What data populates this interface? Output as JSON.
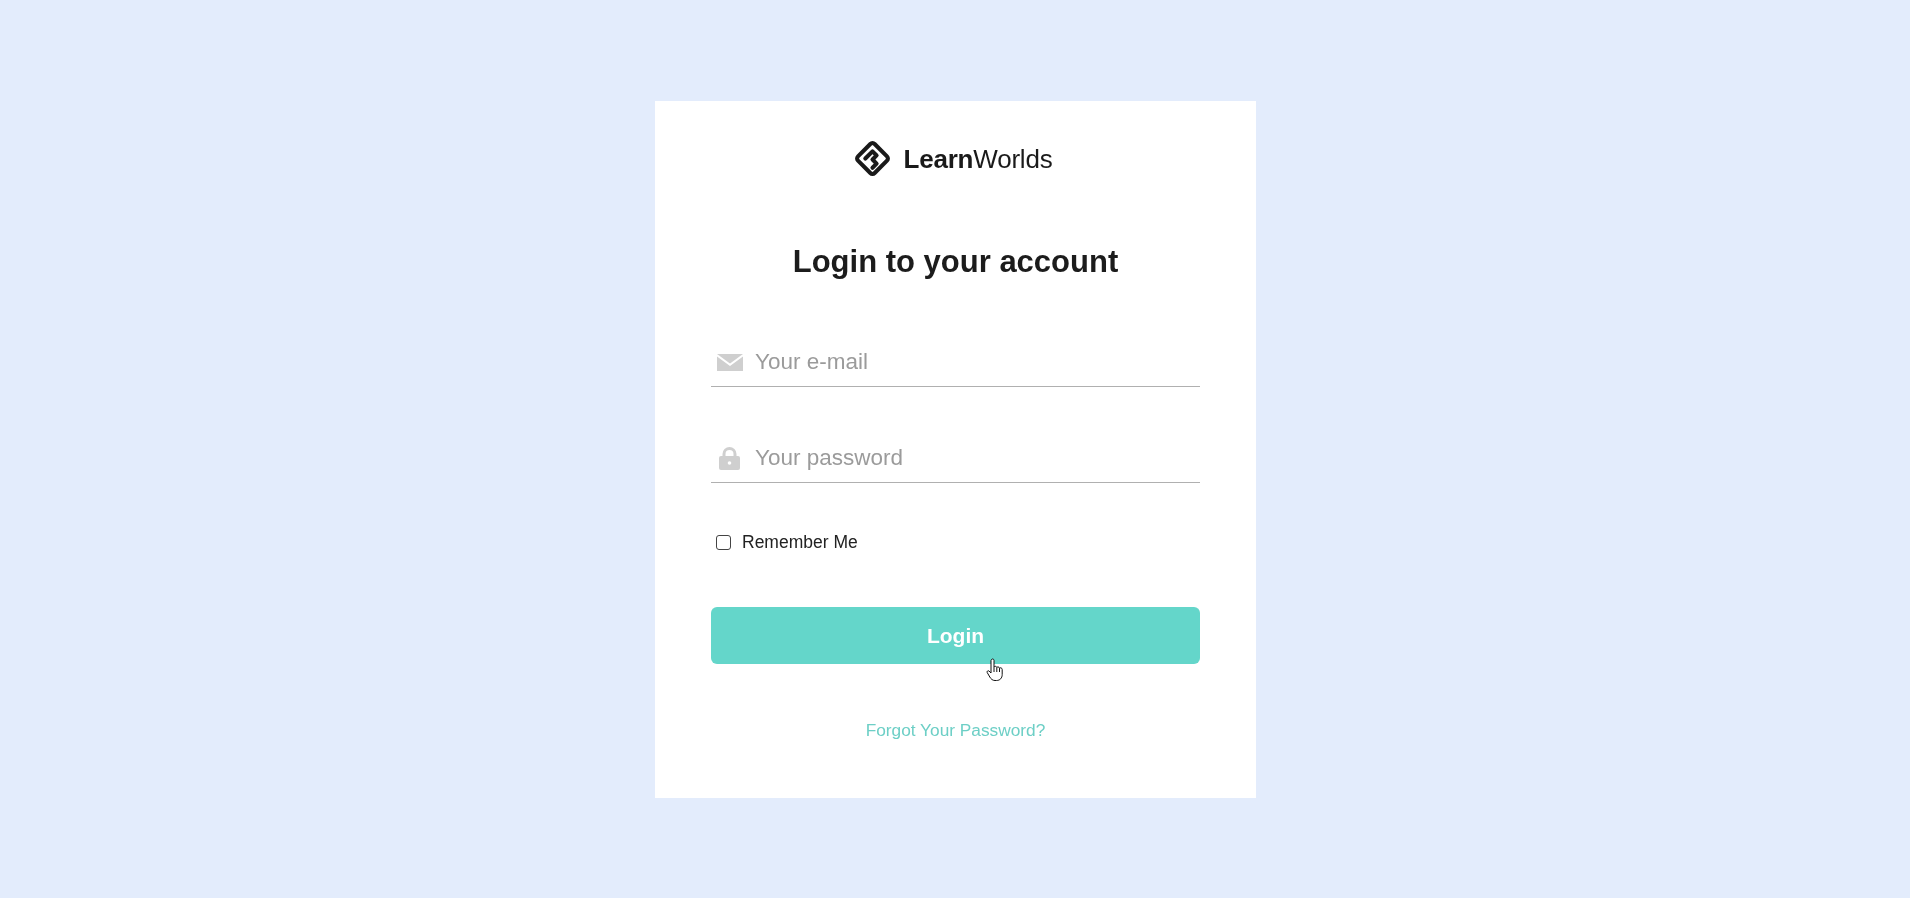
{
  "logo": {
    "wordmark": "**Learn**Worlds"
  },
  "title": "Login to your account",
  "fields": [
    {
      "kind": "email",
      "placeholder": "Your e-mail"
    },
    {
      "kind": "password",
      "placeholder": "Your password"
    }
  ],
  "remember": {
    "label": "Remember Me",
    "checked": false
  },
  "login_button": "Login",
  "forgot_link": "Forgot Your Password?"
}
